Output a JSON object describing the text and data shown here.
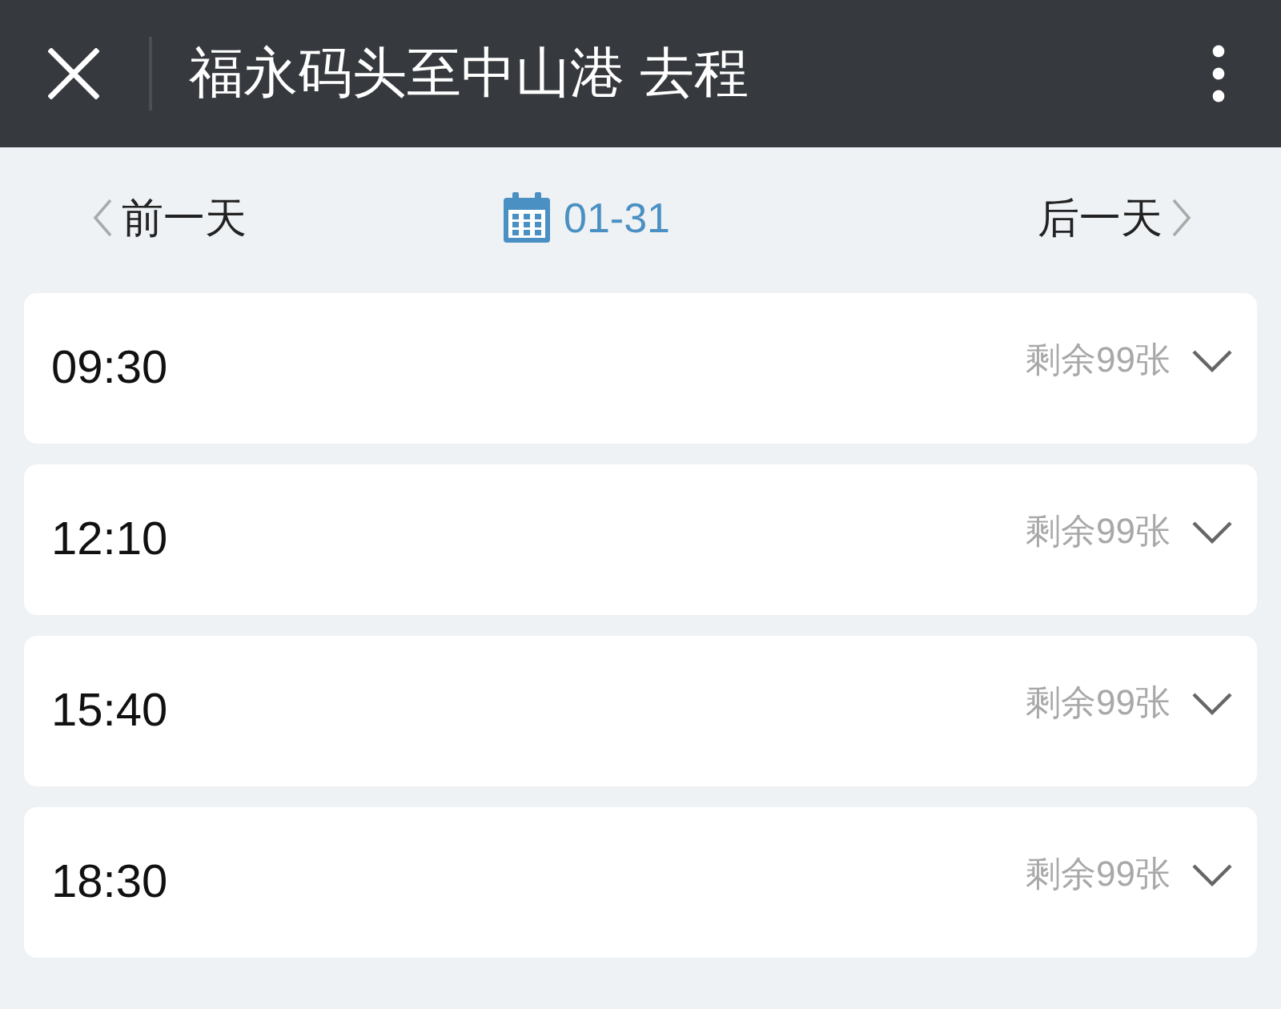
{
  "header": {
    "title": "福永码头至中山港 去程"
  },
  "date_nav": {
    "prev": "前一天",
    "date": "01-31",
    "next": "后一天"
  },
  "departures": [
    {
      "time": "09:30",
      "remaining": "剩余99张",
      "expanded": false
    },
    {
      "time": "12:10",
      "remaining": "剩余99张",
      "expanded": false
    },
    {
      "time": "15:40",
      "remaining": "剩余99张",
      "expanded": false
    },
    {
      "time": "18:30",
      "remaining": "剩余99张",
      "expanded": false
    }
  ]
}
